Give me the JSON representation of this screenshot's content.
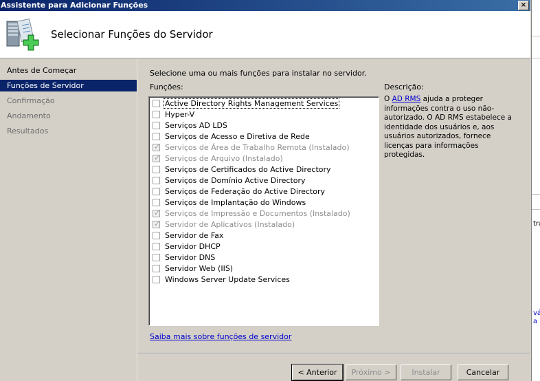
{
  "window": {
    "title": "Assistente para Adicionar Funções",
    "close_label": "×"
  },
  "header": {
    "title": "Selecionar Funções do Servidor"
  },
  "nav": [
    {
      "label": "Antes de Começar",
      "state": "normal"
    },
    {
      "label": "Funções de Servidor",
      "state": "selected"
    },
    {
      "label": "Confirmação",
      "state": "disabled"
    },
    {
      "label": "Andamento",
      "state": "disabled"
    },
    {
      "label": "Resultados",
      "state": "disabled"
    }
  ],
  "main": {
    "instruction": "Selecione uma ou mais funções para instalar no servidor.",
    "roles_label": "Funções:",
    "roles": [
      {
        "label": "Active Directory Rights Management Services",
        "checked": false,
        "disabled": false,
        "focused": true
      },
      {
        "label": "Hyper-V",
        "checked": false,
        "disabled": false
      },
      {
        "label": "Serviços AD LDS",
        "checked": false,
        "disabled": false
      },
      {
        "label": "Serviços de Acesso e Diretiva de Rede",
        "checked": false,
        "disabled": false
      },
      {
        "label": "Serviços de Área de Trabalho Remota  (Instalado)",
        "checked": true,
        "disabled": true
      },
      {
        "label": "Serviços de Arquivo  (Instalado)",
        "checked": true,
        "disabled": true
      },
      {
        "label": "Serviços de Certificados do Active Directory",
        "checked": false,
        "disabled": false
      },
      {
        "label": "Serviços de Domínio Active Directory",
        "checked": false,
        "disabled": false
      },
      {
        "label": "Serviços de Federação do Active Directory",
        "checked": false,
        "disabled": false
      },
      {
        "label": "Serviços de Implantação do Windows",
        "checked": false,
        "disabled": false
      },
      {
        "label": "Serviços de Impressão e Documentos  (Instalado)",
        "checked": true,
        "disabled": true
      },
      {
        "label": "Servidor de Aplicativos  (Instalado)",
        "checked": true,
        "disabled": true
      },
      {
        "label": "Servidor de Fax",
        "checked": false,
        "disabled": false
      },
      {
        "label": "Servidor DHCP",
        "checked": false,
        "disabled": false
      },
      {
        "label": "Servidor DNS",
        "checked": false,
        "disabled": false
      },
      {
        "label": "Servidor Web (IIS)",
        "checked": false,
        "disabled": false
      },
      {
        "label": "Windows Server Update Services",
        "checked": false,
        "disabled": false
      }
    ],
    "description_label": "Descrição:",
    "description_prefix": "O ",
    "description_link": "AD RMS",
    "description_text": " ajuda a proteger informações contra o uso não-autorizado. O AD RMS estabelece a identidade dos usuários e, aos usuários autorizados, fornece licenças para informações protegidas.",
    "more_link": "Saiba mais sobre funções de servidor"
  },
  "buttons": {
    "back": "< Anterior",
    "next": "Próximo >",
    "install": "Instalar",
    "cancel": "Cancelar"
  },
  "background_fragments": [
    "tra",
    "vá",
    "a"
  ]
}
